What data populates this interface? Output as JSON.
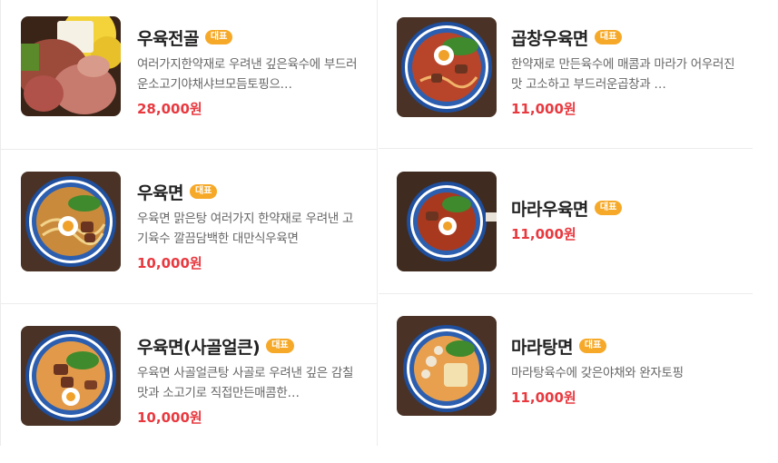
{
  "menu": {
    "left": [
      {
        "name": "우육전골",
        "badge": "대표",
        "desc": "여러가지한약재로 우려낸 깊은육수에 부드러운소고기야채샤브모듬토핑으…",
        "price": "28,000원"
      },
      {
        "name": "우육면",
        "badge": "대표",
        "desc": "우육면 맑은탕 여러가지 한약재로 우려낸 고기육수 깔끔담백한 대만식우육면",
        "price": "10,000원"
      },
      {
        "name": "우육면(사골얼큰)",
        "badge": "대표",
        "desc": "우육면 사골얼큰탕 사골로 우려낸 깊은 감칠맛과 소고기로 직접만든매콤한…",
        "price": "10,000원"
      }
    ],
    "right": [
      {
        "name": "곱창우육면",
        "badge": "대표",
        "desc": "한약재로 만든육수에 매콤과 마라가 어우러진맛 고소하고 부드러운곱창과 …",
        "price": "11,000원"
      },
      {
        "name": "마라우육면",
        "badge": "대표",
        "desc": "",
        "price": "11,000원"
      },
      {
        "name": "마라탕면",
        "badge": "대표",
        "desc": "마라탕육수에 갖은야채와 완자토핑",
        "price": "11,000원"
      }
    ]
  },
  "colors": {
    "badge": "#f6a928",
    "price": "#e8393f"
  },
  "icons": [
    "hotpot-photo",
    "beef-noodle-photo",
    "spicy-beef-noodle-photo",
    "tripe-noodle-photo",
    "mala-beef-noodle-photo",
    "malatang-noodle-photo"
  ]
}
